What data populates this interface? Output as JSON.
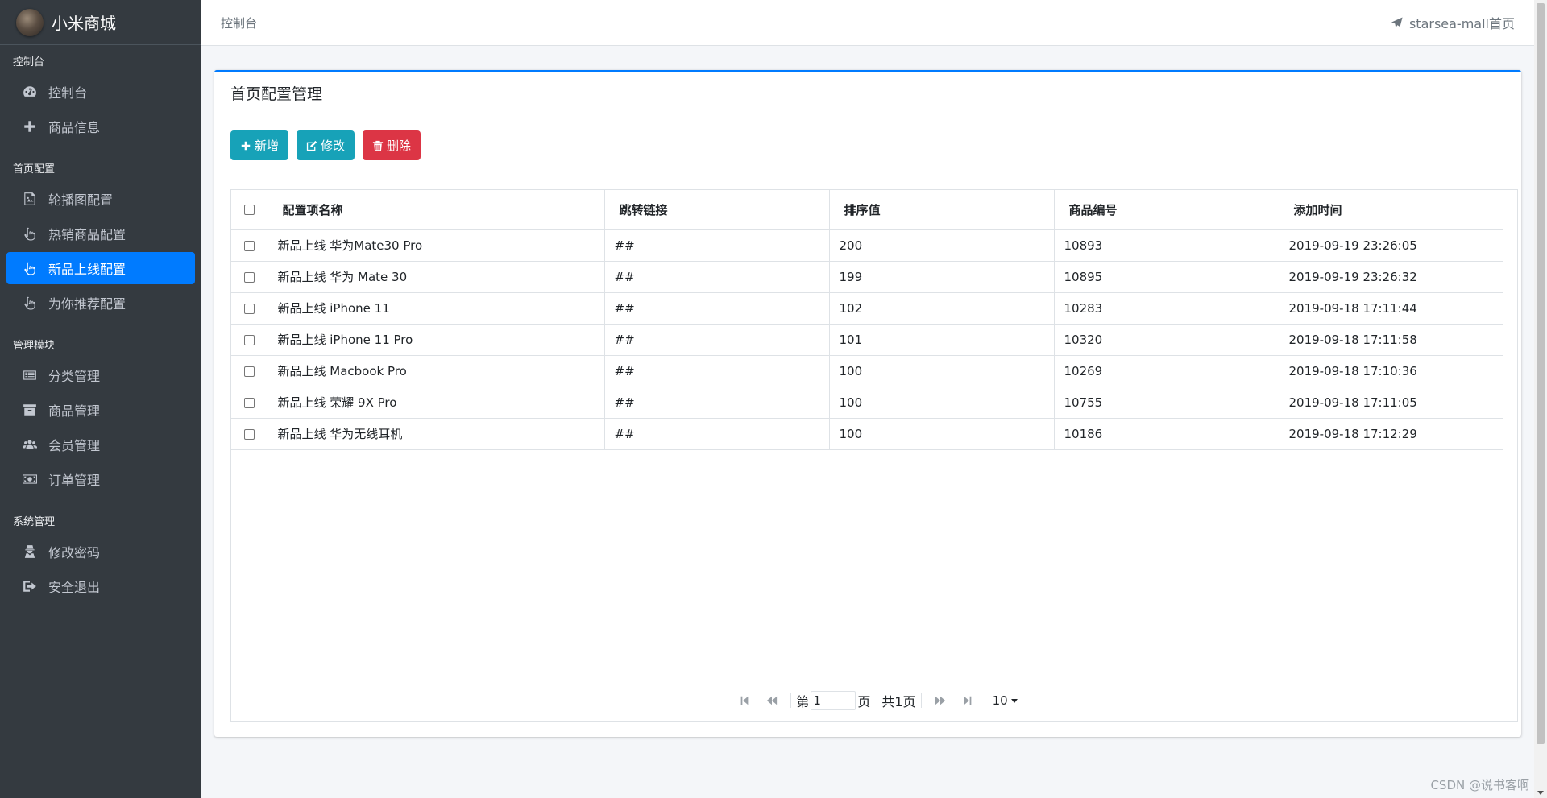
{
  "brand": {
    "title": "小米商城"
  },
  "sidebar": {
    "sections": [
      {
        "header": "控制台",
        "items": [
          {
            "label": "控制台",
            "icon": "dashboard-icon"
          },
          {
            "label": "商品信息",
            "icon": "plus-icon"
          }
        ]
      },
      {
        "header": "首页配置",
        "items": [
          {
            "label": "轮播图配置",
            "icon": "image-icon"
          },
          {
            "label": "热销商品配置",
            "icon": "hand-pointer-icon"
          },
          {
            "label": "新品上线配置",
            "icon": "hand-pointer-icon",
            "active": true
          },
          {
            "label": "为你推荐配置",
            "icon": "hand-pointer-icon"
          }
        ]
      },
      {
        "header": "管理模块",
        "items": [
          {
            "label": "分类管理",
            "icon": "list-icon"
          },
          {
            "label": "商品管理",
            "icon": "archive-icon"
          },
          {
            "label": "会员管理",
            "icon": "users-icon"
          },
          {
            "label": "订单管理",
            "icon": "money-icon"
          }
        ]
      },
      {
        "header": "系统管理",
        "items": [
          {
            "label": "修改密码",
            "icon": "user-secret-icon"
          },
          {
            "label": "安全退出",
            "icon": "sign-out-icon"
          }
        ]
      }
    ]
  },
  "topbar": {
    "breadcrumb": "控制台",
    "home_link": "starsea-mall首页"
  },
  "card": {
    "title": "首页配置管理"
  },
  "toolbar": {
    "add_label": "新增",
    "edit_label": "修改",
    "delete_label": "删除"
  },
  "table": {
    "columns": [
      "配置项名称",
      "跳转链接",
      "排序值",
      "商品编号",
      "添加时间"
    ],
    "rows": [
      [
        "新品上线 华为Mate30 Pro",
        "##",
        "200",
        "10893",
        "2019-09-19 23:26:05"
      ],
      [
        "新品上线 华为 Mate 30",
        "##",
        "199",
        "10895",
        "2019-09-19 23:26:32"
      ],
      [
        "新品上线 iPhone 11",
        "##",
        "102",
        "10283",
        "2019-09-18 17:11:44"
      ],
      [
        "新品上线 iPhone 11 Pro",
        "##",
        "101",
        "10320",
        "2019-09-18 17:11:58"
      ],
      [
        "新品上线 Macbook Pro",
        "##",
        "100",
        "10269",
        "2019-09-18 17:10:36"
      ],
      [
        "新品上线 荣耀 9X Pro",
        "##",
        "100",
        "10755",
        "2019-09-18 17:11:05"
      ],
      [
        "新品上线 华为无线耳机",
        "##",
        "100",
        "10186",
        "2019-09-18 17:12:29"
      ]
    ]
  },
  "pager": {
    "prefix": "第",
    "page_value": "1",
    "suffix": "页",
    "total": "共1页",
    "page_size": "10"
  },
  "watermark": "CSDN @说书客啊",
  "colors": {
    "primary": "#007bff",
    "info": "#17a2b8",
    "danger": "#dc3545",
    "sidebar": "#343a40"
  }
}
